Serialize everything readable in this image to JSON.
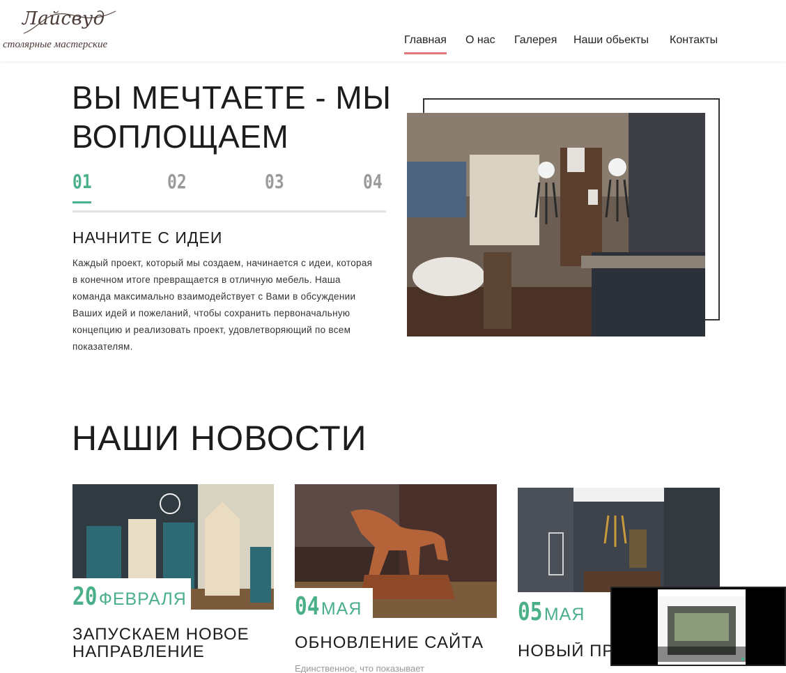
{
  "brand": {
    "logo_script": "Лайсвуд",
    "logo_sub": "столярные мастерские"
  },
  "nav": {
    "items": [
      {
        "label": "Главная",
        "active": true
      },
      {
        "label": "О нас",
        "active": false
      },
      {
        "label": "Галерея",
        "active": false
      },
      {
        "label": "Наши обьекты",
        "active": false
      },
      {
        "label": "Контакты",
        "active": false
      }
    ]
  },
  "hero": {
    "title": "ВЫ МЕЧТАЕТЕ - МЫ ВОПЛОЩАЕМ",
    "steps": [
      "01",
      "02",
      "03",
      "04"
    ],
    "active_step": "01",
    "step_title": "НАЧНИТЕ С ИДЕИ",
    "step_text": "Каждый проект, который мы создаем, начинается с идеи, которая в конечном итоге превращается в отличную мебель. Наша команда максимально взаимодействует с Вами в обсуждении Ваших идей и пожеланий, чтобы сохранить первоначальную концепцию и реализовать проект, удовлетворяющий по всем показателям."
  },
  "news": {
    "title": "НАШИ НОВОСТИ",
    "items": [
      {
        "day": "20",
        "month": "ФЕВРАЛЯ",
        "headline": "ЗАПУСКАЕМ НОВОЕ НАПРАВЛЕНИЕ",
        "excerpt": ""
      },
      {
        "day": "04",
        "month": "МАЯ",
        "headline": "ОБНОВЛЕНИЕ САЙТА",
        "excerpt": "Единственное, что показывает"
      },
      {
        "day": "05",
        "month": "МАЯ",
        "headline": "НОВЫЙ ПР",
        "excerpt": ""
      }
    ]
  },
  "colors": {
    "accent_green": "#4bb08a",
    "nav_underline": "#e07a79",
    "text": "#1c1c1c"
  }
}
